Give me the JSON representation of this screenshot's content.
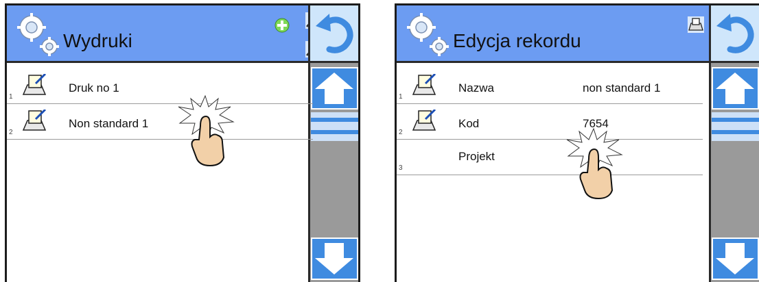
{
  "screens": [
    {
      "title": "Wydruki",
      "header_icons": [
        "add-icon",
        "search-printout-icon",
        "search-record-icon"
      ],
      "rows": [
        {
          "index": "1",
          "label": "Druk no 1"
        },
        {
          "index": "2",
          "label": "Non standard 1"
        }
      ]
    },
    {
      "title": "Edycja rekordu",
      "header_icons": [
        "print-icon"
      ],
      "rows": [
        {
          "index": "1",
          "label": "Nazwa",
          "value": "non standard 1"
        },
        {
          "index": "2",
          "label": "Kod",
          "value": "7654"
        },
        {
          "index": "3",
          "label": "Projekt",
          "value": ""
        }
      ]
    }
  ],
  "colors": {
    "header": "#6c9cf2",
    "button": "#3f8be0",
    "back_button": "#cfe6fb",
    "sidebar": "#9a9a9a"
  }
}
